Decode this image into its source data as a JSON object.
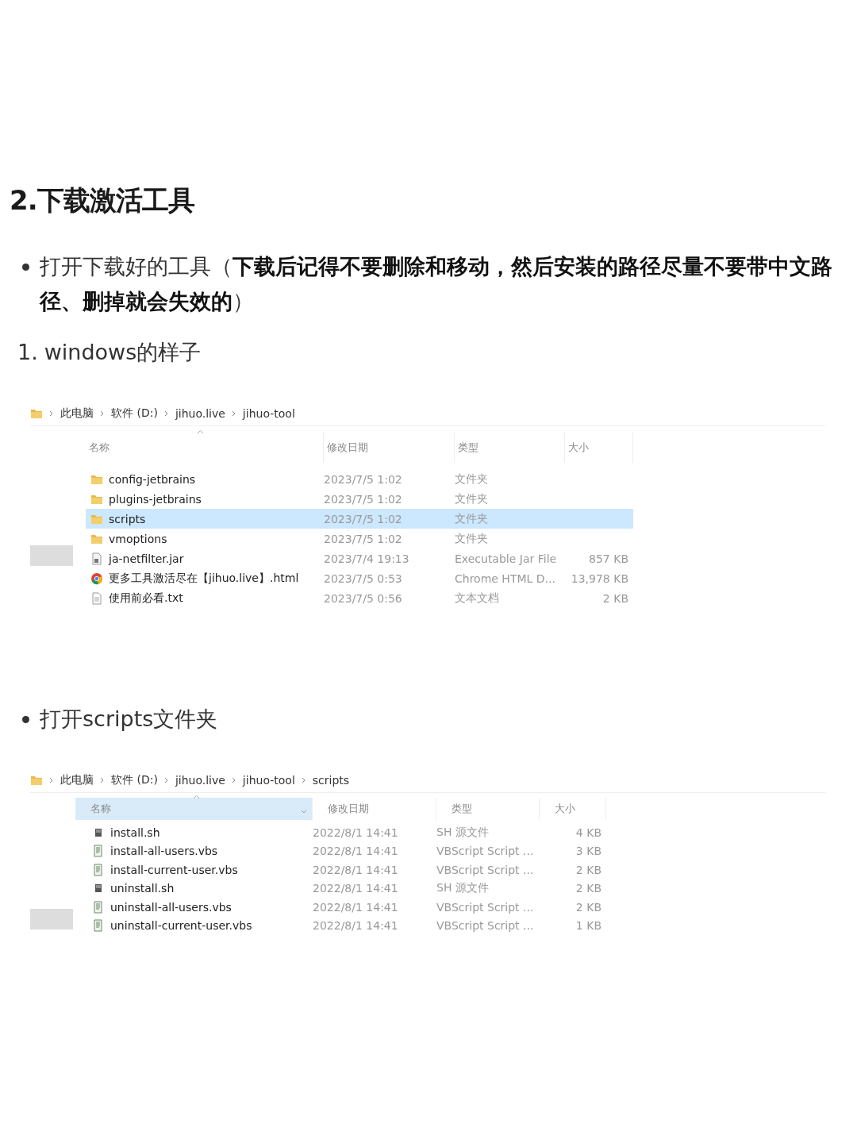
{
  "heading": "2.下载激活工具",
  "blocks": [
    {
      "kind": "bullet",
      "text": "打开下载好的工具（**下载后记得不要删除和移动，然后安装的路径尽量不要带中文路径、删掉就会失效的**）"
    },
    {
      "kind": "numbered",
      "number": "1.",
      "text": "windows的样子"
    },
    {
      "kind": "explorer",
      "breadcrumb": [
        "此电脑",
        "软件 (D:)",
        "jihuo.live",
        "jihuo-tool"
      ],
      "columns": [
        {
          "label": "名称",
          "hovered": false
        },
        {
          "label": "修改日期",
          "hovered": false
        },
        {
          "label": "类型",
          "hovered": false
        },
        {
          "label": "大小",
          "hovered": false
        }
      ],
      "rows": [
        {
          "kind": "folder",
          "name": "config-jetbrains",
          "date": "2023/7/5 1:02",
          "type": "文件夹",
          "selected": false
        },
        {
          "kind": "folder",
          "name": "plugins-jetbrains",
          "date": "2023/7/5 1:02",
          "type": "文件夹",
          "selected": false
        },
        {
          "kind": "folder",
          "name": "scripts",
          "date": "2023/7/5 1:02",
          "type": "文件夹",
          "selected": true
        },
        {
          "kind": "folder",
          "name": "vmoptions",
          "date": "2023/7/5 1:02",
          "type": "文件夹",
          "selected": false
        },
        {
          "kind": "jar",
          "name": "ja-netfilter.jar",
          "date": "2023/7/4 19:13",
          "type": "Executable Jar File",
          "size": "857 KB",
          "selected": false
        },
        {
          "kind": "chrome",
          "name": "更多工具激活尽在【jihuo.live】.html",
          "date": "2023/7/5 0:53",
          "type": "Chrome HTML D...",
          "size": "13,978 KB",
          "selected": false
        },
        {
          "kind": "txt",
          "name": "使用前必看.txt",
          "date": "2023/7/5 0:56",
          "type": "文本文档",
          "size": "2 KB",
          "selected": false
        }
      ]
    },
    {
      "kind": "bullet",
      "text": "打开scripts文件夹"
    },
    {
      "kind": "explorer",
      "breadcrumb": [
        "此电脑",
        "软件 (D:)",
        "jihuo.live",
        "jihuo-tool",
        "scripts"
      ],
      "columns": [
        {
          "label": "名称",
          "hovered": true
        },
        {
          "label": "修改日期",
          "hovered": false
        },
        {
          "label": "类型",
          "hovered": false
        },
        {
          "label": "大小",
          "hovered": false
        }
      ],
      "rows": [
        {
          "kind": "sh",
          "name": "install.sh",
          "date": "2022/8/1 14:41",
          "type": "SH 源文件",
          "size": "4 KB",
          "selected": false
        },
        {
          "kind": "vbs",
          "name": "install-all-users.vbs",
          "date": "2022/8/1 14:41",
          "type": "VBScript Script ...",
          "size": "3 KB",
          "selected": false
        },
        {
          "kind": "vbs",
          "name": "install-current-user.vbs",
          "date": "2022/8/1 14:41",
          "type": "VBScript Script ...",
          "size": "2 KB",
          "selected": false
        },
        {
          "kind": "sh",
          "name": "uninstall.sh",
          "date": "2022/8/1 14:41",
          "type": "SH 源文件",
          "size": "2 KB",
          "selected": false
        },
        {
          "kind": "vbs",
          "name": "uninstall-all-users.vbs",
          "date": "2022/8/1 14:41",
          "type": "VBScript Script ...",
          "size": "2 KB",
          "selected": false
        },
        {
          "kind": "vbs",
          "name": "uninstall-current-user.vbs",
          "date": "2022/8/1 14:41",
          "type": "VBScript Script ...",
          "size": "1 KB",
          "selected": false
        }
      ]
    }
  ]
}
